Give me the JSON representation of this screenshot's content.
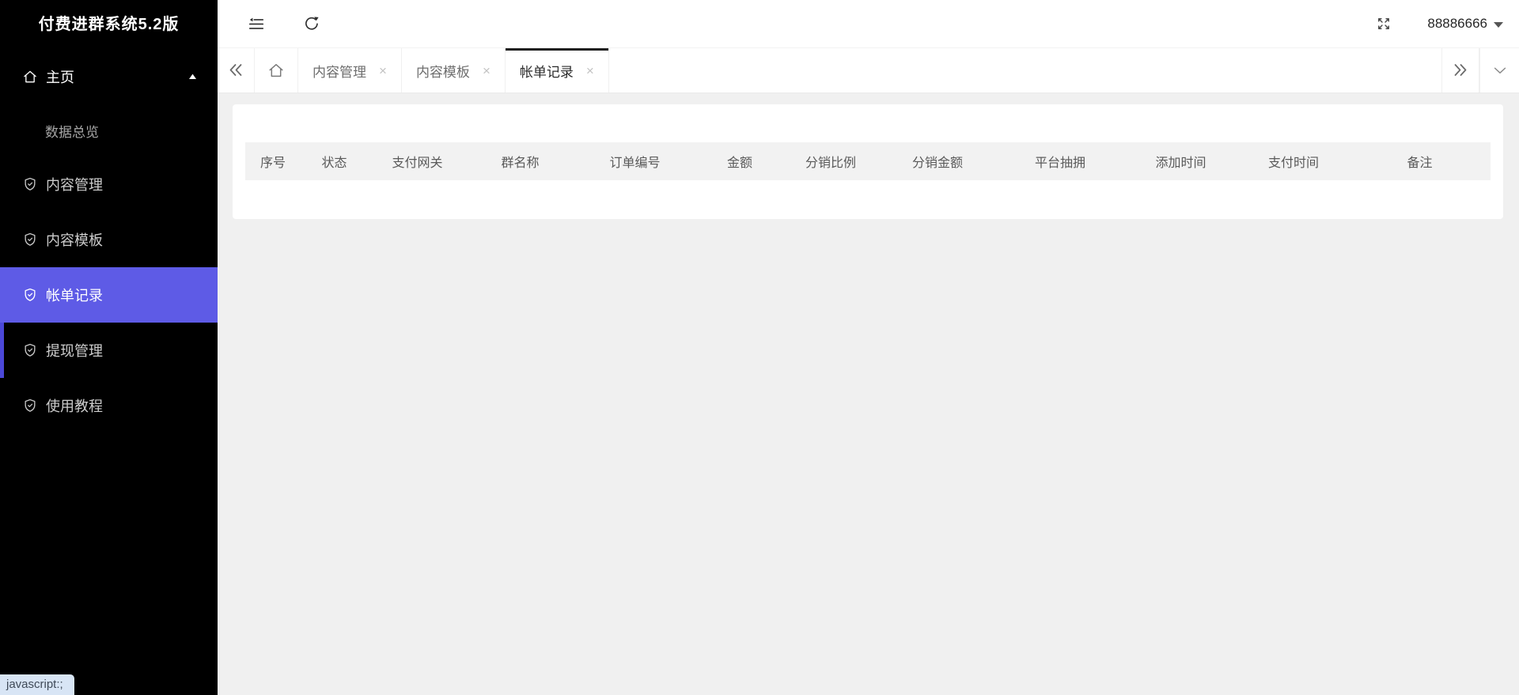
{
  "app": {
    "title": "付费进群系统5.2版"
  },
  "colors": {
    "accent": "#5e5be6",
    "accent_marker": "#4b48d8",
    "sidebar_bg": "#000000",
    "content_bg": "#f0f0f0",
    "table_header_bg": "#f2f2f2",
    "active_tab_border": "#1f1f1f",
    "status_tip_bg": "#d8e5f5"
  },
  "sidebar": {
    "items": [
      {
        "label": "主页",
        "icon": "home-icon",
        "state": "expanded"
      },
      {
        "label": "数据总览",
        "type": "submenu-item"
      },
      {
        "label": "内容管理",
        "icon": "shield-check-icon"
      },
      {
        "label": "内容模板",
        "icon": "shield-check-icon"
      },
      {
        "label": "帐单记录",
        "icon": "shield-check-icon",
        "state": "active"
      },
      {
        "label": "提现管理",
        "icon": "shield-check-icon",
        "state": "marked"
      },
      {
        "label": "使用教程",
        "icon": "shield-check-icon"
      }
    ]
  },
  "topbar": {
    "username": "88886666",
    "icons": [
      "collapse-menu-icon",
      "refresh-icon",
      "fullscreen-icon",
      "caret-down-icon"
    ]
  },
  "tabbar": {
    "close_glyph": "×",
    "icons": [
      "chevrons-left-icon",
      "home-icon",
      "chevrons-right-icon",
      "chevron-down-icon"
    ],
    "tabs": [
      {
        "label": "内容管理",
        "closable": true,
        "active": false
      },
      {
        "label": "内容模板",
        "closable": true,
        "active": false
      },
      {
        "label": "帐单记录",
        "closable": true,
        "active": true
      }
    ]
  },
  "table": {
    "columns": [
      "序号",
      "状态",
      "支付网关",
      "群名称",
      "订单编号",
      "金额",
      "分销比例",
      "分销金额",
      "平台抽拥",
      "添加时间",
      "支付时间",
      "备注"
    ],
    "rows": []
  },
  "statusbar": {
    "text": "javascript:;"
  }
}
